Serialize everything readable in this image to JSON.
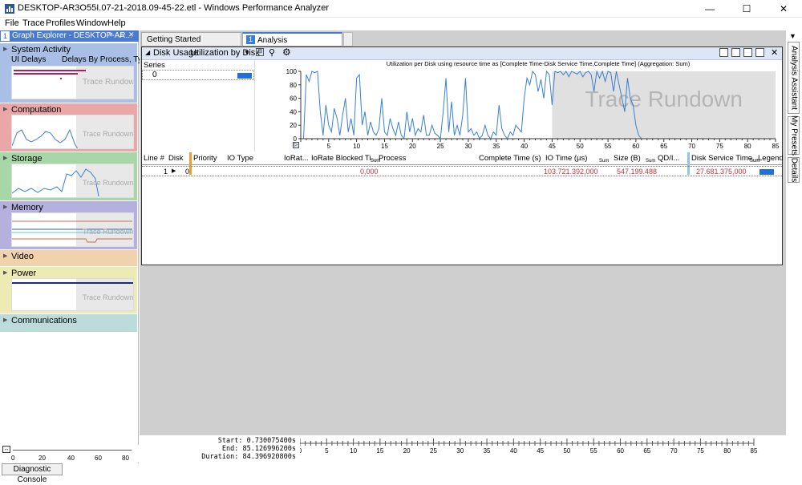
{
  "window": {
    "title": "DESKTOP-AR3O55I.07-21-2018.09-45-22.etl - Windows Performance Analyzer",
    "controls": {
      "minimize": "—",
      "maximize": "☐",
      "close": "✕"
    }
  },
  "menu": [
    "File",
    "Trace",
    "Profiles",
    "Window",
    "Help"
  ],
  "graph_explorer": {
    "number": "1",
    "title": "Graph Explorer - DESKTOP-AR...",
    "categories": [
      {
        "label": "System Activity",
        "sub1": "UI Delays",
        "sub2": "Delays By Process, Type",
        "rundown": "Trace Rundown"
      },
      {
        "label": "Computation",
        "rundown": "Trace Rundown"
      },
      {
        "label": "Storage",
        "rundown": "Trace Rundown"
      },
      {
        "label": "Memory",
        "rundown": "Trace Rundown"
      },
      {
        "label": "Video"
      },
      {
        "label": "Power",
        "rundown": "Trace Rundown"
      },
      {
        "label": "Communications"
      }
    ],
    "ruler_ticks": [
      "0",
      "20",
      "40",
      "60",
      "80"
    ]
  },
  "diagnostic_console": "Diagnostic Console",
  "tabs": [
    {
      "label": "Getting Started"
    },
    {
      "number": "1",
      "label": "Analysis"
    }
  ],
  "disk_usage": {
    "graph_name": "Disk Usage",
    "preset": "Utilization by Disk",
    "series_header": "Series",
    "series_value": "0",
    "chart_title": "Utilization per Disk using resource time as [Complete Time-Disk Service Time,Complete Time] (Aggregation: Sum)",
    "rundown": "Trace Rundown"
  },
  "chart_data": {
    "type": "line",
    "title": "Utilization per Disk using resource time as [Complete Time-Disk Service Time,Complete Time] (Aggregation: Sum)",
    "xlabel": "",
    "ylabel": "",
    "xlim": [
      0,
      85
    ],
    "ylim": [
      0,
      100
    ],
    "x_ticks": [
      5,
      10,
      15,
      20,
      25,
      30,
      35,
      40,
      45,
      50,
      55,
      60,
      65,
      70,
      75,
      80,
      85
    ],
    "y_ticks": [
      0,
      20,
      40,
      60,
      80,
      100
    ],
    "rundown_region": [
      45,
      85
    ],
    "series": [
      {
        "color": "#3a7fd5",
        "x": [
          0.5,
          1,
          1.5,
          2,
          2.5,
          3,
          3.5,
          4,
          4.5,
          5,
          5.5,
          6,
          6.5,
          7,
          7.5,
          8,
          8.5,
          9,
          9.5,
          10,
          10.5,
          11,
          11.5,
          12,
          12.5,
          13,
          13.5,
          14,
          14.5,
          15,
          15.5,
          16,
          16.5,
          17,
          17.5,
          18,
          18.5,
          19,
          19.5,
          20,
          20.5,
          21,
          21.5,
          22,
          22.5,
          23,
          23.5,
          24,
          24.5,
          25,
          25.5,
          26,
          26.5,
          27,
          27.5,
          28,
          28.5,
          29,
          29.5,
          30,
          30.5,
          31,
          31.5,
          32,
          32.5,
          33,
          33.5,
          34,
          34.5,
          35,
          35.5,
          36,
          36.5,
          37,
          37.5,
          38,
          38.5,
          39,
          39.5,
          40,
          40.5,
          41,
          41.5,
          42,
          42.5,
          43,
          43.5,
          44,
          44.5,
          45,
          45.5,
          46,
          46.5,
          47,
          47.5,
          48,
          48.5,
          49,
          49.5,
          50,
          50.5,
          51,
          51.5,
          52,
          52.5,
          53,
          53.5,
          54,
          54.5,
          55,
          55.5,
          56,
          56.5,
          57,
          57.5,
          58,
          58.5,
          59,
          59.5,
          60,
          60.5,
          61
        ],
        "values": [
          0,
          95,
          85,
          100,
          98,
          100,
          40,
          5,
          50,
          20,
          10,
          45,
          30,
          5,
          35,
          60,
          10,
          30,
          5,
          90,
          95,
          20,
          40,
          5,
          25,
          10,
          5,
          15,
          60,
          10,
          5,
          30,
          15,
          5,
          25,
          5,
          0,
          40,
          10,
          30,
          5,
          15,
          10,
          35,
          5,
          5,
          20,
          8,
          5,
          0,
          40,
          90,
          10,
          55,
          5,
          20,
          5,
          35,
          90,
          10,
          15,
          5,
          10,
          0,
          5,
          20,
          5,
          0,
          10,
          5,
          50,
          15,
          5,
          0,
          10,
          5,
          20,
          15,
          10,
          60,
          90,
          80,
          100,
          95,
          70,
          88,
          60,
          100,
          95,
          50,
          100,
          98,
          100,
          95,
          100,
          92,
          100,
          98,
          96,
          100,
          92,
          98,
          100,
          95,
          70,
          100,
          90,
          100,
          85,
          100,
          98,
          70,
          100,
          80,
          60,
          40,
          90,
          60,
          50,
          20,
          5,
          0
        ]
      }
    ]
  },
  "table": {
    "columns": [
      "Line #",
      "Disk",
      "Priority",
      "IO Type",
      "IoRat...",
      "IoRate Blocked Ti...",
      "Process",
      "Complete Time (s)",
      "IO Time (µs)",
      "Size (B)",
      "QD/I...",
      "Disk Service Time...",
      "Legend"
    ],
    "sum_label": "Sum",
    "rows": [
      {
        "line": "1",
        "disk": "0",
        "io_rate_blocked": "0,000",
        "io_time": "103.721.392,000",
        "size": "547.199.488",
        "disk_service_time": "27.681.375,000"
      }
    ]
  },
  "timeline": {
    "start_label": "Start:",
    "start": "0.730075400s",
    "end_label": "End:",
    "end": "85.126996200s",
    "duration_label": "Duration:",
    "duration": "84.396920800s",
    "ticks": [
      "0",
      "5",
      "10",
      "15",
      "20",
      "25",
      "30",
      "35",
      "40",
      "45",
      "50",
      "55",
      "60",
      "65",
      "70",
      "75",
      "80",
      "85"
    ]
  },
  "right_tabs": [
    "Analysis Assistant",
    "My Presets",
    "Details"
  ],
  "colors": {
    "system_activity": "#a9bfe5",
    "computation": "#e9a7a7",
    "storage": "#a7d7a7",
    "memory": "#b6b0de",
    "video": "#f0d2ad",
    "power": "#eeeab3",
    "communications": "#bcdcdc",
    "accent": "#3a7fd5",
    "highlight_red": "#d0313c"
  }
}
